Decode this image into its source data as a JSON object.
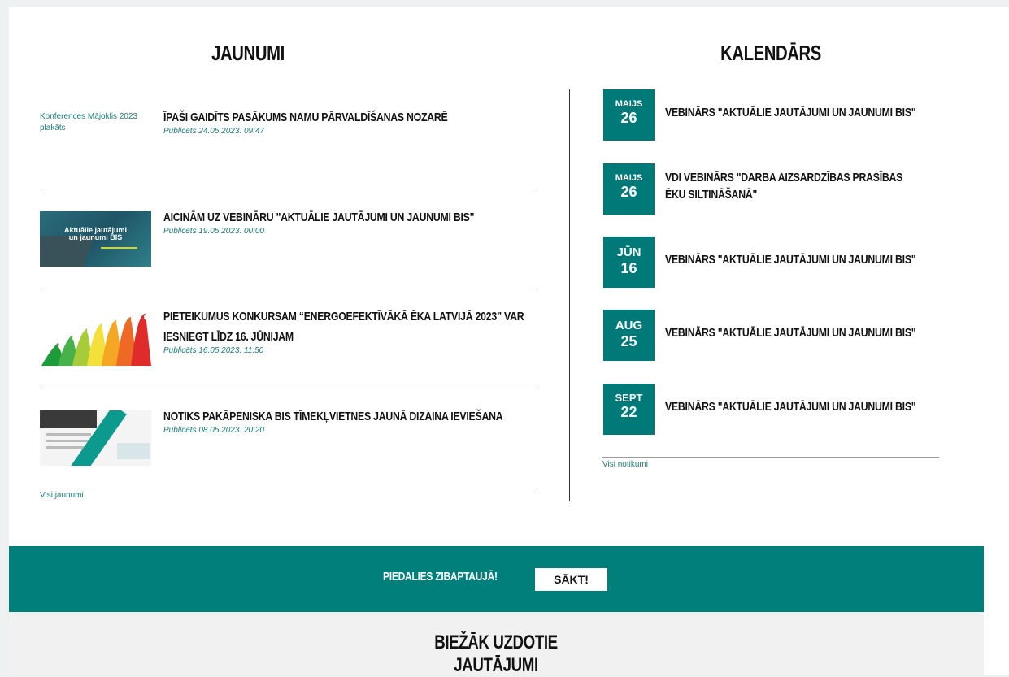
{
  "news": {
    "title": "Jaunumi",
    "all_link": "Visi jaunumi",
    "items": [
      {
        "thumb_alt": "Konferences Mājoklis 2023 plakāts",
        "headline": "Īpaši gaidīts pasākums namu pārvaldīšanas nozarē",
        "date": "Publicēts 24.05.2023. 09:47"
      },
      {
        "thumb_line1": "Aktuālie jautājumi",
        "thumb_line2": "un jaunumi BIS",
        "headline": "Aicinām uz vebināru \"Aktuālie jautājumi un jaunumi BIS\"",
        "date": "Publicēts 19.05.2023. 00:00"
      },
      {
        "headline": "Pieteikumus konkursam “Energoefektīvākā ēka Latvijā 2023” var iesniegt līdz 16. jūnijam",
        "date": "Publicēts 16.05.2023. 11:50"
      },
      {
        "headline": "Notiks pakāpeniska BIS tīmekļvietnes jaunā dizaina ieviešana",
        "date": "Publicēts 08.05.2023. 20:20"
      }
    ]
  },
  "calendar": {
    "title": "Kalendārs",
    "all_link": "Visi notikumi",
    "events": [
      {
        "month": "MAIJS",
        "day": "26",
        "text": "Vebinārs \"Aktuālie jautājumi un jaunumi BIS\""
      },
      {
        "month": "MAIJS",
        "day": "26",
        "text": "VDI vebinārs \"Darba aizsardzības prasības ēku siltināšanā\""
      },
      {
        "month": "JŪN",
        "day": "16",
        "text": "Vebinārs \"Aktuālie jautājumi un jaunumi BIS\""
      },
      {
        "month": "AUG",
        "day": "25",
        "text": "Vebinārs \"Aktuālie jautājumi un jaunumi BIS\""
      },
      {
        "month": "SEPT",
        "day": "22",
        "text": "Vebinārs \"Aktuālie jautājumi un jaunumi BIS\""
      }
    ]
  },
  "banner": {
    "text": "Piedalies zibaptaujā!",
    "button": "SĀKT!"
  },
  "faq": {
    "title": "Biežāk uzdotie jautājumi"
  },
  "colors": {
    "accent": "#007a78",
    "link": "#1a7d75"
  }
}
